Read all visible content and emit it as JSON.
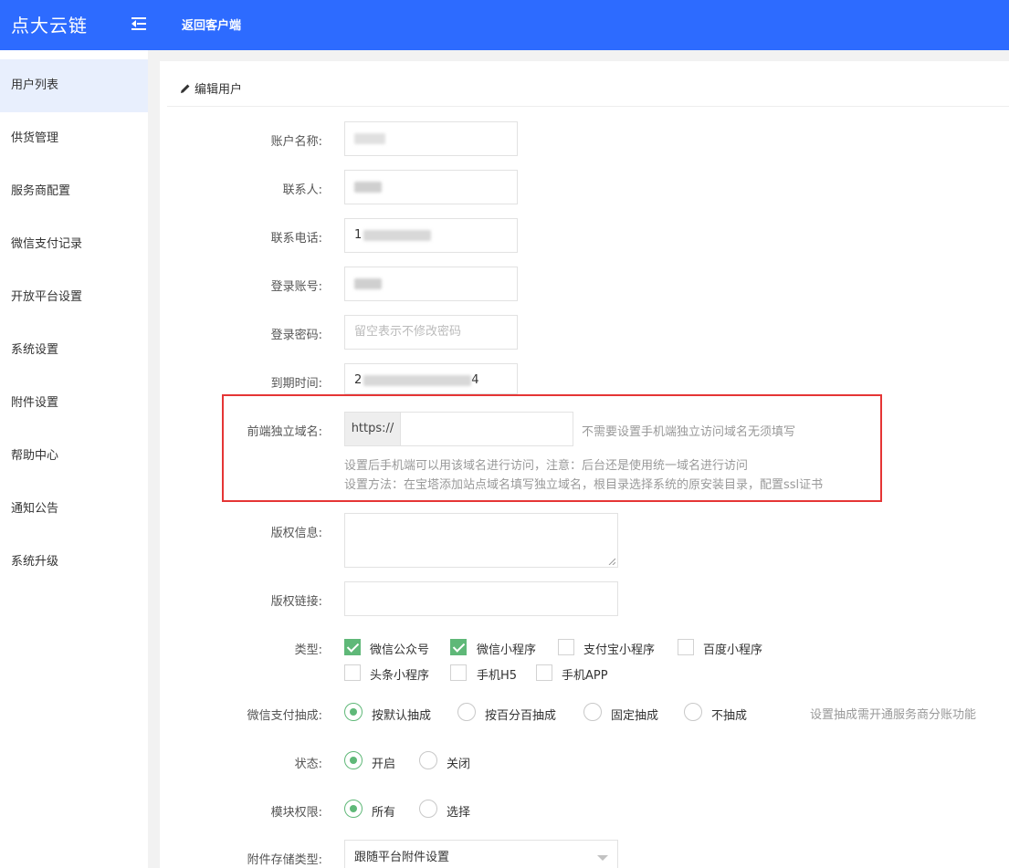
{
  "header": {
    "logo": "点大云链",
    "back_link": "返回客户端"
  },
  "sidebar": {
    "items": [
      {
        "label": "用户列表",
        "active": true
      },
      {
        "label": "供货管理"
      },
      {
        "label": "服务商配置"
      },
      {
        "label": "微信支付记录"
      },
      {
        "label": "开放平台设置"
      },
      {
        "label": "系统设置"
      },
      {
        "label": "附件设置"
      },
      {
        "label": "帮助中心"
      },
      {
        "label": "通知公告"
      },
      {
        "label": "系统升级"
      }
    ]
  },
  "panel": {
    "title": "编辑用户"
  },
  "form": {
    "account_name": {
      "label": "账户名称:"
    },
    "contact": {
      "label": "联系人:"
    },
    "phone": {
      "label": "联系电话:",
      "visible_prefix": "1"
    },
    "login_account": {
      "label": "登录账号:"
    },
    "password": {
      "label": "登录密码:",
      "placeholder": "留空表示不修改密码"
    },
    "expire": {
      "label": "到期时间:",
      "visible_start": "2",
      "visible_end": "4"
    },
    "domain": {
      "label": "前端独立域名:",
      "prefix": "https://",
      "aside": "不需要设置手机端独立访问域名无须填写",
      "help1": "设置后手机端可以用该域名进行访问，注意：后台还是使用统一域名进行访问",
      "help2": "设置方法：在宝塔添加站点域名填写独立域名，根目录选择系统的原安装目录，配置ssl证书"
    },
    "copyright_info": {
      "label": "版权信息:"
    },
    "copyright_link": {
      "label": "版权链接:"
    },
    "type": {
      "label": "类型:",
      "options": [
        {
          "label": "微信公众号",
          "checked": true
        },
        {
          "label": "微信小程序",
          "checked": true
        },
        {
          "label": "支付宝小程序",
          "checked": false
        },
        {
          "label": "百度小程序",
          "checked": false
        },
        {
          "label": "头条小程序",
          "checked": false
        },
        {
          "label": "手机H5",
          "checked": false
        },
        {
          "label": "手机APP",
          "checked": false
        }
      ]
    },
    "commission": {
      "label": "微信支付抽成:",
      "options": [
        "按默认抽成",
        "按百分百抽成",
        "固定抽成",
        "不抽成"
      ],
      "selected": "按默认抽成",
      "aside": "设置抽成需开通服务商分账功能"
    },
    "status": {
      "label": "状态:",
      "options": [
        "开启",
        "关闭"
      ],
      "selected": "开启"
    },
    "module": {
      "label": "模块权限:",
      "options": [
        "所有",
        "选择"
      ],
      "selected": "所有"
    },
    "storage": {
      "label": "附件存储类型:",
      "value": "跟随平台附件设置"
    }
  },
  "colors": {
    "topbar": "#2d6bff",
    "active_sidebar": "#e8effd",
    "checked": "#5fb878",
    "highlight_border": "#e53535"
  }
}
